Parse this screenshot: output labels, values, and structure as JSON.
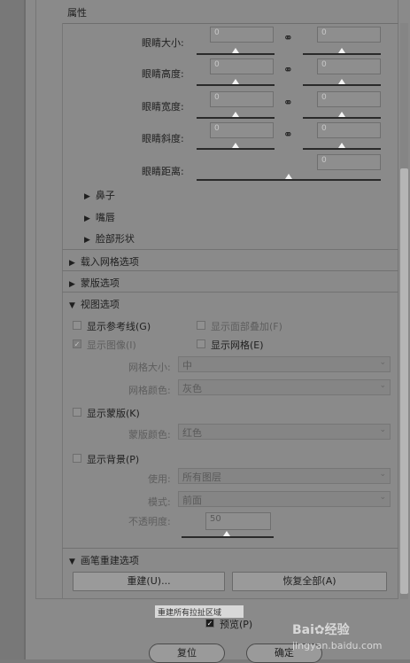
{
  "panel": {
    "title": "属性"
  },
  "eyes": {
    "size_label": "眼睛大小:",
    "height_label": "眼睛高度:",
    "width_label": "眼睛宽度:",
    "tilt_label": "眼睛斜度:",
    "distance_label": "眼睛距离:",
    "size_left": "0",
    "size_right": "0",
    "height_left": "0",
    "height_right": "0",
    "width_left": "0",
    "width_right": "0",
    "tilt_left": "0",
    "tilt_right": "0",
    "distance": "0",
    "link_icon": "chain-link-icon"
  },
  "subsections": {
    "nose": "鼻子",
    "mouth": "嘴唇",
    "face_shape": "脸部形状"
  },
  "sections": {
    "load_mesh": "载入网格选项",
    "mask": "蒙版选项",
    "view": "视图选项",
    "brush_rebuild": "画笔重建选项"
  },
  "view_options": {
    "show_guides": "显示参考线(G)",
    "show_face_overlay": "显示面部叠加(F)",
    "show_image": "显示图像(I)",
    "show_mesh": "显示网格(E)",
    "mesh_size_label": "网格大小:",
    "mesh_size_value": "中",
    "mesh_color_label": "网格颜色:",
    "mesh_color_value": "灰色",
    "show_mask": "显示蒙版(K)",
    "mask_color_label": "蒙版颜色:",
    "mask_color_value": "红色",
    "show_background": "显示背景(P)",
    "use_label": "使用:",
    "use_value": "所有图层",
    "mode_label": "模式:",
    "mode_value": "前面",
    "opacity_label": "不透明度:",
    "opacity_value": "50"
  },
  "brush_rebuild": {
    "rebuild_btn": "重建(U)...",
    "restore_all_btn": "恢复全部(A)"
  },
  "tooltip": "重建所有拉扯区域",
  "footer": {
    "preview": "预览(P)",
    "reset_btn": "复位",
    "ok_btn": "确定"
  },
  "watermark": {
    "brand": "Bai",
    "suffix": "经验",
    "domain": "jingyan.baidu.com"
  }
}
